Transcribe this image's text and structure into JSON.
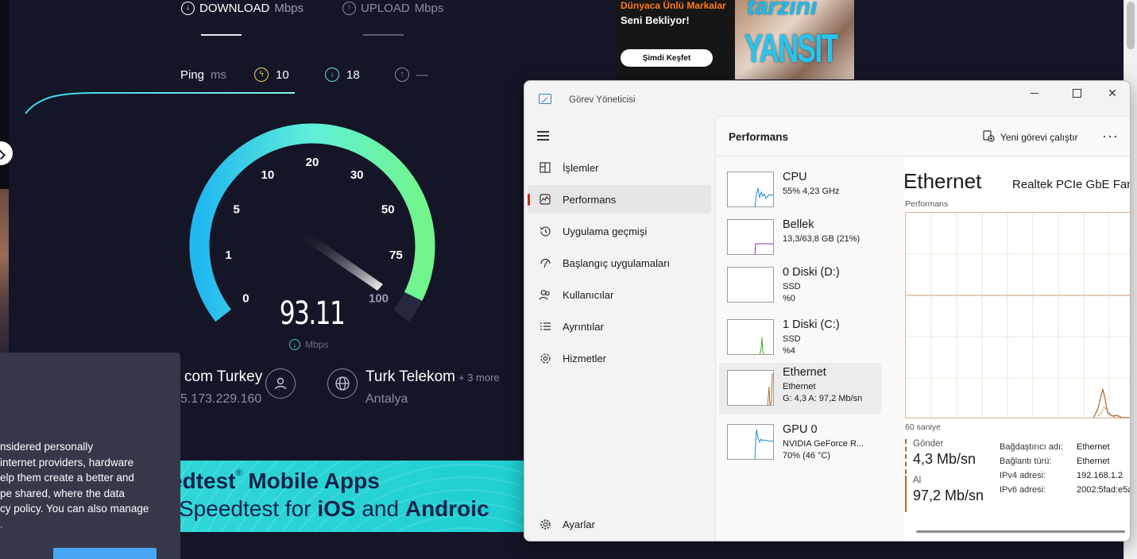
{
  "speedtest": {
    "download_label": "DOWNLOAD",
    "upload_label": "UPLOAD",
    "unit": "Mbps",
    "ping_label": "Ping",
    "ping_unit": "ms",
    "ping_jitter": "10",
    "ping_download": "18",
    "ping_upload": "—",
    "gauge_ticks": [
      "0",
      "1",
      "5",
      "10",
      "20",
      "30",
      "50",
      "75",
      "100"
    ],
    "gauge_value": "93.11",
    "gauge_unit": "Mbps",
    "isp_name": "com Turkey",
    "isp_ip": "5.173.229.160",
    "server_name": "Turk Telekom",
    "server_more": "+ 3 more",
    "server_location": "Antalya",
    "banner_line1": "edtest",
    "banner_reg": "®",
    "banner_line1_rest": " Mobile Apps",
    "banner_line2_pre": "Speedtest for ",
    "banner_ios": "iOS",
    "banner_and": " and ",
    "banner_android": "Androic",
    "consent_lines": [
      "nsidered personally",
      "internet providers, hardware",
      "elp them create a better and",
      "pe shared, where the data",
      "cy policy. You can also manage",
      "."
    ],
    "ad_line1": "Dünyaca Ünlü Markalar",
    "ad_line2": "Seni Bekliyor!",
    "ad_button": "Şimdi Keşfet",
    "ad_slogan1": "tarzını",
    "ad_slogan2": "YANSIT",
    "accent_colors": {
      "gauge_start": "#21b8f0",
      "gauge_end": "#72f58a",
      "banner": "#2fd6d8"
    }
  },
  "taskmgr": {
    "window_title": "Görev Yöneticisi",
    "nav": [
      {
        "label": "İşlemler",
        "icon": "processes-icon"
      },
      {
        "label": "Performans",
        "icon": "performance-icon"
      },
      {
        "label": "Uygulama geçmişi",
        "icon": "history-icon"
      },
      {
        "label": "Başlangıç uygulamaları",
        "icon": "startup-icon"
      },
      {
        "label": "Kullanıcılar",
        "icon": "users-icon"
      },
      {
        "label": "Ayrıntılar",
        "icon": "details-icon"
      },
      {
        "label": "Hizmetler",
        "icon": "services-icon"
      }
    ],
    "settings_label": "Ayarlar",
    "page_title": "Performans",
    "run_new_task": "Yeni görevi çalıştır",
    "resources": [
      {
        "name": "CPU",
        "line2": "55% 4,23 GHz",
        "line3": ""
      },
      {
        "name": "Bellek",
        "line2": "13,3/63,8 GB (21%)",
        "line3": ""
      },
      {
        "name": "0 Diski (D:)",
        "line2": "SSD",
        "line3": "%0"
      },
      {
        "name": "1 Diski (C:)",
        "line2": "SSD",
        "line3": "%4"
      },
      {
        "name": "Ethernet",
        "line2": "Ethernet",
        "line3": "G: 4,3  A: 97,2 Mb/sn"
      },
      {
        "name": "GPU 0",
        "line2": "NVIDIA GeForce R...",
        "line3": "70%  (46 °C)"
      }
    ],
    "detail": {
      "title": "Ethernet",
      "adapter": "Realtek PCIe GbE Fam",
      "graph_label": "Performans",
      "time_label": "60 saniye",
      "send_label": "Gönder",
      "send_value": "4,3 Mb/sn",
      "recv_label": "Al",
      "recv_value": "97,2 Mb/sn",
      "props": [
        {
          "k": "Bağdaştırıcı adı:",
          "v": "Ethernet"
        },
        {
          "k": "Bağlantı türü:",
          "v": "Ethernet"
        },
        {
          "k": "IPv4 adresi:",
          "v": "192.168.1.2"
        },
        {
          "k": "IPv6 adresi:",
          "v": "2002:5fad:e5a"
        }
      ]
    },
    "colors": {
      "active_indicator": "#c42b1c",
      "network_line": "#a86a33",
      "cpu_line": "#1a8ad4",
      "memory_line": "#8f2fa8",
      "disk_line": "#4aa832"
    }
  }
}
